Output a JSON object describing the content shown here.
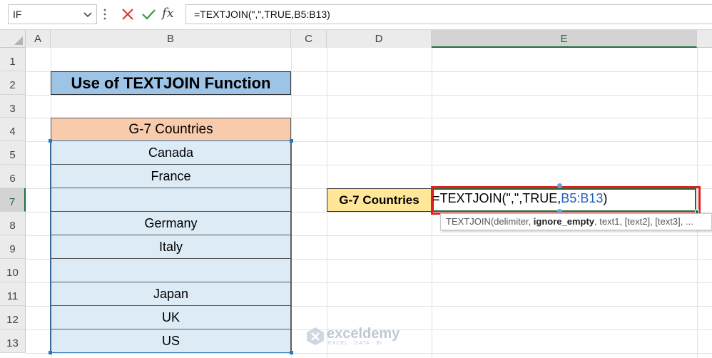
{
  "formula_bar": {
    "name_box": "IF",
    "cancel_icon": "close-icon",
    "enter_icon": "check-icon",
    "fx_label": "fx",
    "formula": "=TEXTJOIN(\",\",TRUE,B5:B13)"
  },
  "columns": [
    "A",
    "B",
    "C",
    "D",
    "E"
  ],
  "rows": [
    "1",
    "2",
    "3",
    "4",
    "5",
    "6",
    "7",
    "8",
    "9",
    "10",
    "11",
    "12",
    "13"
  ],
  "sheet": {
    "title": "Use of TEXTJOIN Function",
    "table_header": "G-7 Countries",
    "countries": [
      "Canada",
      "France",
      "",
      "Germany",
      "Italy",
      "",
      "Japan",
      "UK",
      "US"
    ],
    "label_cell": "G-7 Countries",
    "edit_formula_prefix": "=TEXTJOIN(\",\",TRUE,",
    "edit_formula_ref": "B5:B13",
    "edit_formula_suffix": ")"
  },
  "tooltip": {
    "fn": "TEXTJOIN(delimiter, ",
    "bold_arg": "ignore_empty",
    "rest": ", text1, [text2], [text3], ..."
  },
  "watermark": {
    "name": "exceldemy",
    "tagline": "EXCEL · DATA · BI"
  },
  "colors": {
    "title_fill": "#9dc3e6",
    "header_fill": "#f8cbad",
    "cell_fill": "#ddebf7",
    "label_fill": "#ffe699",
    "highlight_border": "#e02020",
    "excel_green": "#1e6b3a"
  }
}
